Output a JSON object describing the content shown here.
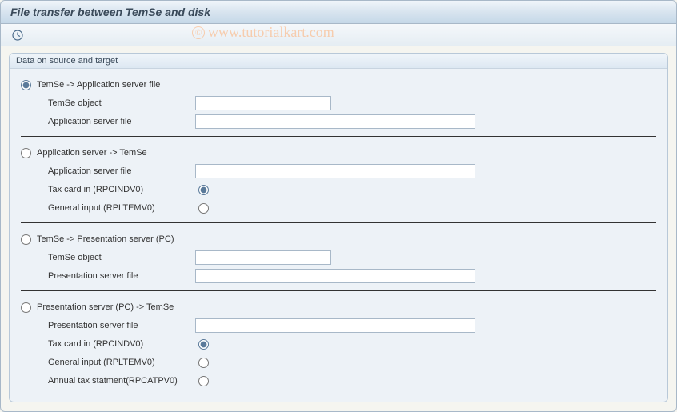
{
  "header": {
    "title": "File transfer between TemSe and disk"
  },
  "watermark": {
    "symbol": "©",
    "text": "www.tutorialkart.com"
  },
  "group": {
    "title": "Data on source and target",
    "sections": [
      {
        "direction_label": "TemSe -> Application server file",
        "direction_selected": true,
        "fields": [
          {
            "label": "TemSe object",
            "value": "",
            "width": "short"
          },
          {
            "label": "Application server file",
            "value": "",
            "width": "long"
          }
        ]
      },
      {
        "direction_label": "Application server -> TemSe",
        "direction_selected": false,
        "fields": [
          {
            "label": "Application server file",
            "value": "",
            "width": "long"
          }
        ],
        "sub_radios": [
          {
            "label": "Tax card in (RPCINDV0)",
            "selected": true
          },
          {
            "label": "General input (RPLTEMV0)",
            "selected": false
          }
        ]
      },
      {
        "direction_label": "TemSe -> Presentation server (PC)",
        "direction_selected": false,
        "fields": [
          {
            "label": "TemSe object",
            "value": "",
            "width": "short"
          },
          {
            "label": "Presentation server file",
            "value": "",
            "width": "long"
          }
        ]
      },
      {
        "direction_label": "Presentation server (PC) -> TemSe",
        "direction_selected": false,
        "fields": [
          {
            "label": "Presentation server file",
            "value": "",
            "width": "long"
          }
        ],
        "sub_radios": [
          {
            "label": "Tax card in (RPCINDV0)",
            "selected": true
          },
          {
            "label": "General input (RPLTEMV0)",
            "selected": false
          },
          {
            "label": "Annual tax statment(RPCATPV0)",
            "selected": false
          }
        ]
      }
    ]
  }
}
